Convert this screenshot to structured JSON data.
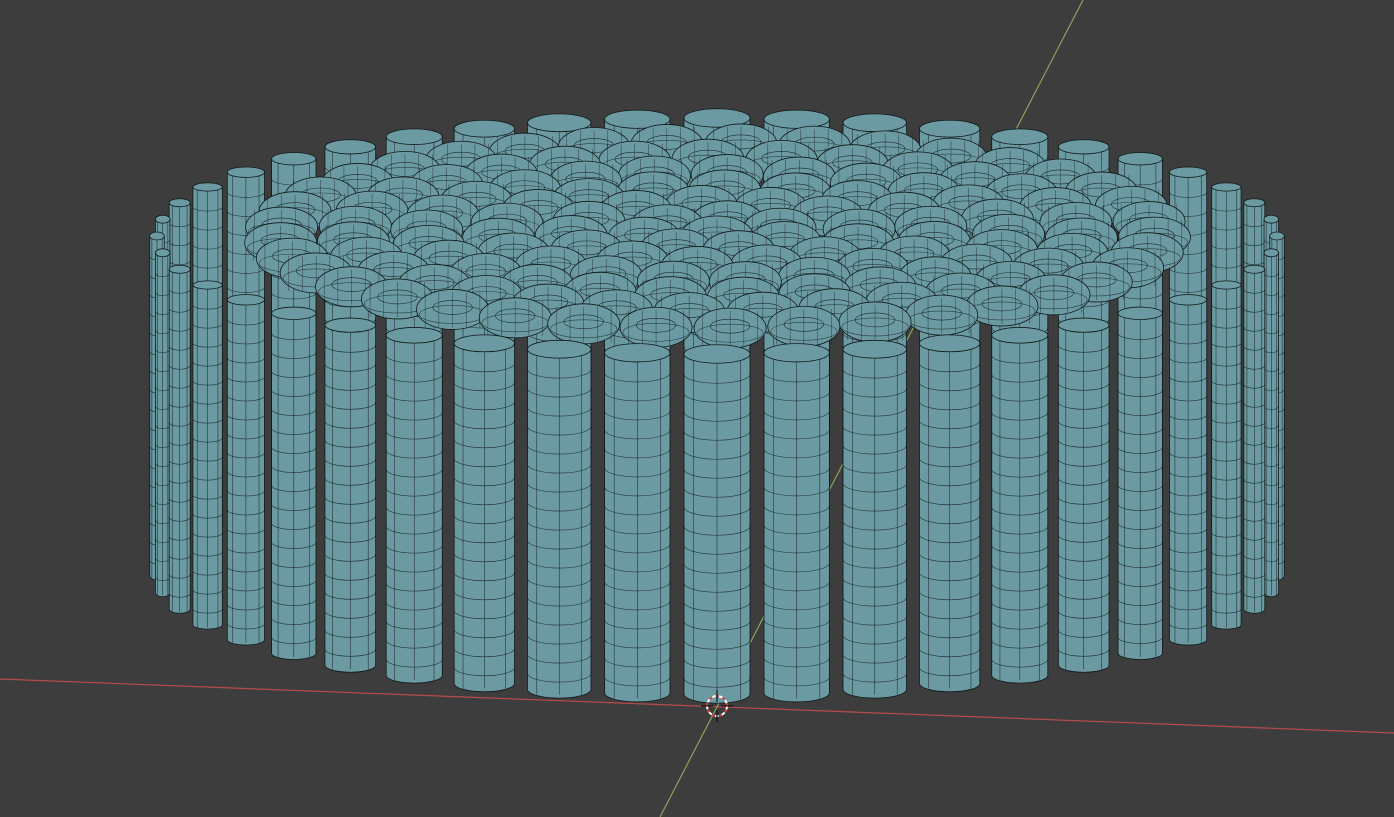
{
  "viewport": {
    "background_color": "#3d3d3d",
    "mesh_face_color": "#6b9aa2",
    "mesh_wire_color": "#111a1c",
    "x_axis_color": "#b94b4b",
    "y_axis_color": "#8aa35a",
    "cursor_icon": "3d-cursor-icon"
  }
}
